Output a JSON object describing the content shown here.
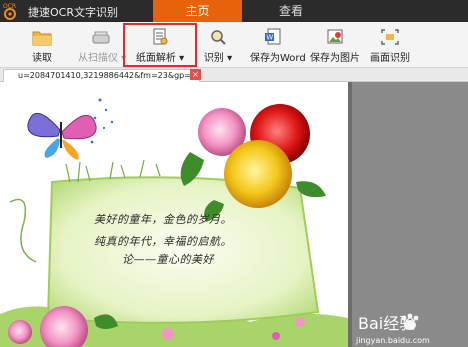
{
  "app": {
    "logo_text": "OCR",
    "title": "捷速OCR文字识别"
  },
  "menu_tabs": [
    {
      "label": "主页",
      "active": true
    },
    {
      "label": "查看",
      "active": false
    }
  ],
  "toolbar": {
    "read": "读取",
    "scan": "从扫描仪",
    "layout": "纸面解析",
    "recognize": "识别",
    "save_word": "保存为Word",
    "save_image": "保存为图片",
    "area_recognize": "画面识别"
  },
  "document": {
    "tab_name": "u=2084701410,3219886442&fm=23&gp=0.jpg",
    "close_label": "×"
  },
  "image_text": {
    "line1": "美好的童年，金色的岁月。",
    "line2": "纯真的年代，幸福的启航。",
    "line3": "论——童心的美好"
  },
  "watermark": {
    "brand": "Bai经验",
    "url": "jingyan.baidu.com"
  },
  "colors": {
    "accent": "#e8620b",
    "highlight": "#e12a2a"
  }
}
